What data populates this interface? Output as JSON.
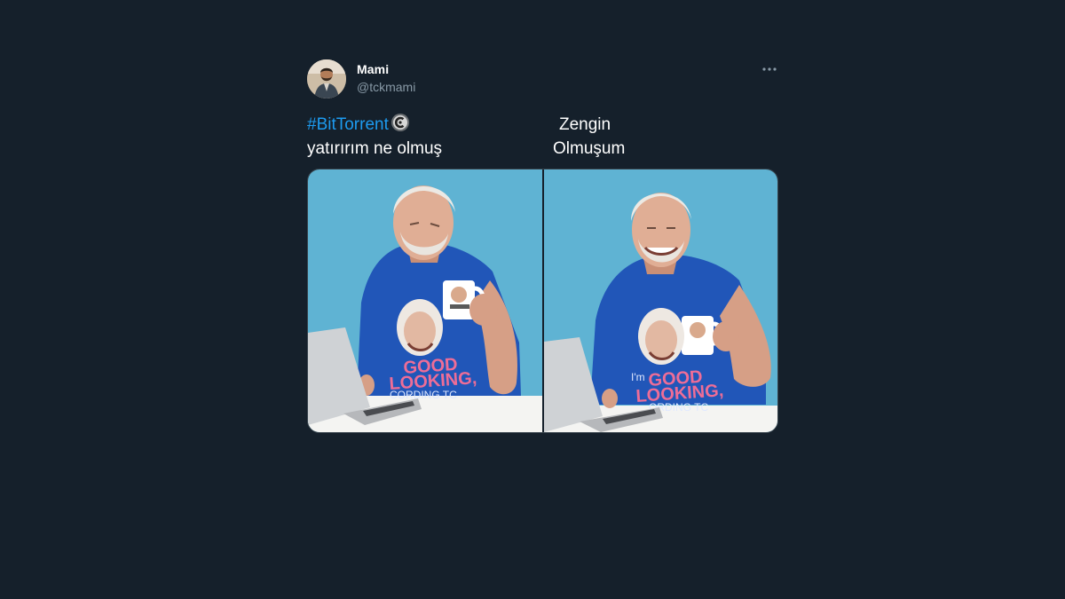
{
  "tweet": {
    "author": {
      "display_name": "Mami",
      "handle": "@tckmami",
      "avatar_icon": "user-avatar-photo"
    },
    "more_icon": "more-horizontal-icon",
    "text_left": {
      "hashtag": "#BitTorrent",
      "hashtag_icon": "bittorrent-coin-icon",
      "line2": "yatırırım ne olmuş"
    },
    "text_right": {
      "line1": "Zengin",
      "line2": "Olmuşum"
    },
    "media": {
      "left_shirt_text_1": "GOOD",
      "left_shirt_text_2": "LOOKING,",
      "left_shirt_text_3": "CORDING TC",
      "right_shirt_text_1": "GOOD",
      "right_shirt_text_2": "LOOKING,",
      "right_shirt_text_3": "ORDING TC",
      "right_shirt_prefix": "I'm"
    }
  },
  "colors": {
    "background": "#15202b",
    "hashtag": "#1d9bf0",
    "text": "#ffffff",
    "muted": "#8899a6",
    "photo_bg": "#5fb3d3",
    "shirt": "#2156b8"
  }
}
